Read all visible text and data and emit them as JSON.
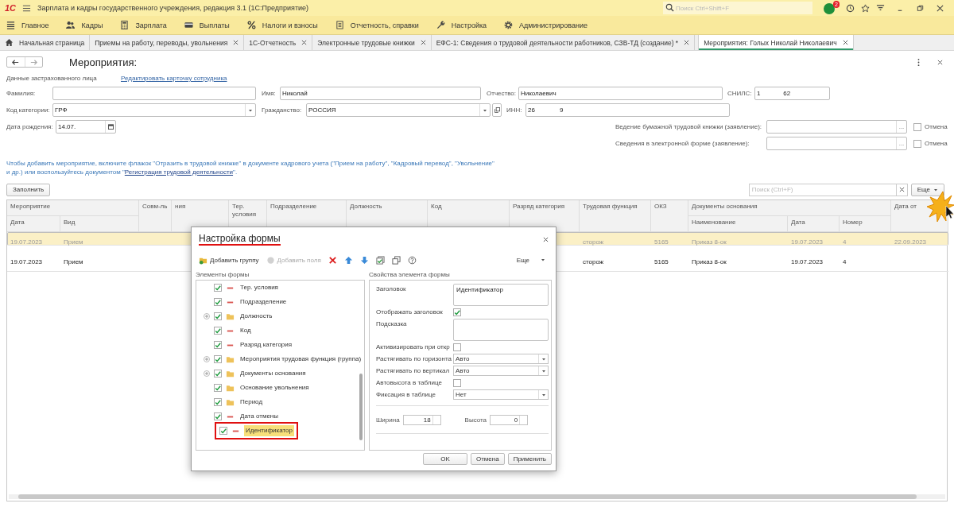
{
  "app_bar": {
    "logo": "1С",
    "title": "Зарплата и кадры государственного учреждения, редакция 3.1  (1С:Предприятие)",
    "search": {
      "placeholder": "Поиск Ctrl+Shift+F"
    },
    "notifications": "2"
  },
  "sections": [
    {
      "label": "Главное",
      "kind": "lines"
    },
    {
      "label": "Кадры",
      "kind": "people"
    },
    {
      "label": "Зарплата",
      "kind": "calculator"
    },
    {
      "label": "Выплаты",
      "kind": "card"
    },
    {
      "label": "Налоги и взносы",
      "kind": "percent"
    },
    {
      "label": "Отчетность, справки",
      "kind": "document"
    },
    {
      "label": "Настройка",
      "kind": "wrench"
    },
    {
      "label": "Администрирование",
      "kind": "gear"
    }
  ],
  "tabs": [
    {
      "label": "Начальная страница",
      "kind": "home",
      "selected": false
    },
    {
      "label": "Приемы на работу, переводы, увольнения",
      "kind": "page",
      "selected": false
    },
    {
      "label": "1С-Отчетность",
      "kind": "page",
      "selected": false
    },
    {
      "label": "Электронные трудовые книжки",
      "kind": "page",
      "selected": false
    },
    {
      "label": "ЕФС-1: Сведения о трудовой деятельности работников, СЗВ-ТД (создание) *",
      "kind": "page",
      "selected": false
    },
    {
      "label": "Мероприятия: Голых Николай Николаевич",
      "kind": "page",
      "selected": true
    }
  ],
  "form": {
    "title": "Мероприятия:",
    "section_label": "Данные застрахованного лица",
    "edit_link": "Редактировать карточку сотрудника",
    "surname": {
      "label": "Фамилия:"
    },
    "name": {
      "label": "Имя:",
      "value": "Николай"
    },
    "patronymic": {
      "label": "Отчество:",
      "value": "Николаевич"
    },
    "snils": {
      "label": "СНИЛС:",
      "value": "1             62"
    },
    "category": {
      "label": "Код категории:",
      "value": "ГРФ"
    },
    "citizenship": {
      "label": "Гражданство:",
      "value": "РОССИЯ"
    },
    "inn": {
      "label": "ИНН:",
      "value": "26              9"
    },
    "birth_date": {
      "label": "Дата рождения:",
      "value": "14.07."
    },
    "statements": [
      {
        "label": "Ведение бумажной трудовой книжки (заявление):",
        "picker": "...",
        "cancel_label": "Отмена",
        "cancelled": false
      },
      {
        "label": "Сведения в электронной форме (заявление):",
        "picker": "...",
        "cancel_label": "Отмена",
        "cancelled": false
      }
    ],
    "info": {
      "line1": "Чтобы добавить мероприятие, включите флажок \"Отразить в трудовой книжке\" в документе кадрового учета (\"Прием на работу\", \"Кадровый перевод\", \"Увольнение\"",
      "line2": "и др.) или воспользуйтесь документом \"",
      "link": "Регистрация трудовой деятельности",
      "after": "\"."
    },
    "fill_button": "Заполнить",
    "table_search": {
      "placeholder": "Поиск (Ctrl+F)"
    },
    "more_button": "Еще"
  },
  "table": {
    "header_groups": [
      {
        "label": "Мероприятие"
      },
      {
        "label": "Документы основания"
      }
    ],
    "columns": [
      {
        "label": "Дата",
        "grouped": true
      },
      {
        "label": "Вид",
        "grouped": true
      },
      {
        "label": "Совм-ль",
        "grouped": false
      },
      {
        "label": "ния",
        "grouped": false
      },
      {
        "label": "Тер. условия",
        "grouped": false
      },
      {
        "label": "Подразделение",
        "grouped": false
      },
      {
        "label": "Должность",
        "grouped": false
      },
      {
        "label": "Код",
        "grouped": false
      },
      {
        "label": "Разряд категория",
        "grouped": false
      },
      {
        "label": "Трудовая функция",
        "grouped": false
      },
      {
        "label": "ОКЗ",
        "grouped": false
      },
      {
        "label": "Наименование",
        "grouped": true
      },
      {
        "label": "Дата",
        "grouped": true
      },
      {
        "label": "Номер",
        "grouped": true
      },
      {
        "label": "Дата от",
        "grouped": false
      }
    ],
    "rows": [
      {
        "selected": true,
        "cancelled": true,
        "cells": [
          "19.07.2023",
          "Прием",
          null,
          null,
          null,
          null,
          null,
          null,
          null,
          "сторож",
          "5165",
          "Приказ 8-ок",
          "19.07.2023",
          "4",
          "22.09.2023"
        ]
      },
      {
        "selected": false,
        "cancelled": false,
        "cells": [
          "19.07.2023",
          "Прием",
          null,
          null,
          null,
          null,
          null,
          null,
          null,
          "сторож",
          "5165",
          "Приказ 8-ок",
          "19.07.2023",
          "4",
          null
        ]
      }
    ]
  },
  "dialog": {
    "title": "Настройка формы",
    "toolbar": [
      {
        "kind": "add-group",
        "label": "Добавить группу",
        "disabled": false
      },
      {
        "kind": "add-fields",
        "label": "Добавить поля",
        "disabled": true
      },
      {
        "kind": "delete",
        "disabled": false
      },
      {
        "kind": "up",
        "disabled": false
      },
      {
        "kind": "down",
        "disabled": false
      },
      {
        "kind": "check-all",
        "disabled": false
      },
      {
        "kind": "copy",
        "disabled": false
      },
      {
        "kind": "help",
        "disabled": false
      }
    ],
    "more": "Еще",
    "tree_title": "Элементы формы",
    "tree": [
      {
        "label": "Тер. условия",
        "kind": "field",
        "checked": true,
        "selected": false
      },
      {
        "label": "Подразделение",
        "kind": "field",
        "checked": true,
        "selected": false
      },
      {
        "label": "Должность",
        "kind": "folder",
        "checked": true,
        "expanded": false,
        "selected": false
      },
      {
        "label": "Код",
        "kind": "field",
        "checked": true,
        "selected": false
      },
      {
        "label": "Разряд категория",
        "kind": "field",
        "checked": true,
        "selected": false
      },
      {
        "label": "Мероприятия трудовая функция (группа)",
        "kind": "folder",
        "checked": true,
        "expanded": false,
        "selected": false
      },
      {
        "label": "Документы основания",
        "kind": "folder",
        "checked": true,
        "expanded": false,
        "selected": false
      },
      {
        "label": "Основание увольнения",
        "kind": "folder",
        "checked": true,
        "selected": false
      },
      {
        "label": "Период",
        "kind": "folder",
        "checked": true,
        "selected": false
      },
      {
        "label": "Дата отмены",
        "kind": "field",
        "checked": true,
        "selected": false
      },
      {
        "label": "Идентификатор",
        "kind": "field",
        "checked": true,
        "selected": true
      }
    ],
    "props_title": "Свойства элемента формы",
    "props": [
      {
        "kind": "textarea",
        "label": "Заголовок",
        "value": "Идентификатор"
      },
      {
        "kind": "checkbox",
        "label": "Отображать заголовок",
        "checked": true
      },
      {
        "kind": "textarea",
        "label": "Подсказка"
      },
      {
        "kind": "checkbox",
        "label": "Активизировать при откр",
        "checked": false
      },
      {
        "kind": "select",
        "label": "Растягивать по горизонта",
        "value": "Авто"
      },
      {
        "kind": "select",
        "label": "Растягивать по вертикал",
        "value": "Авто"
      },
      {
        "kind": "checkbox",
        "label": "Автовысота в таблице",
        "checked": false
      },
      {
        "kind": "select",
        "label": "Фиксация в таблице",
        "value": "Нет"
      }
    ],
    "width": {
      "label": "Ширина",
      "value": "18"
    },
    "height": {
      "label": "Высота",
      "value": "0"
    },
    "buttons": [
      "OK",
      "Отмена",
      "Применить"
    ]
  }
}
